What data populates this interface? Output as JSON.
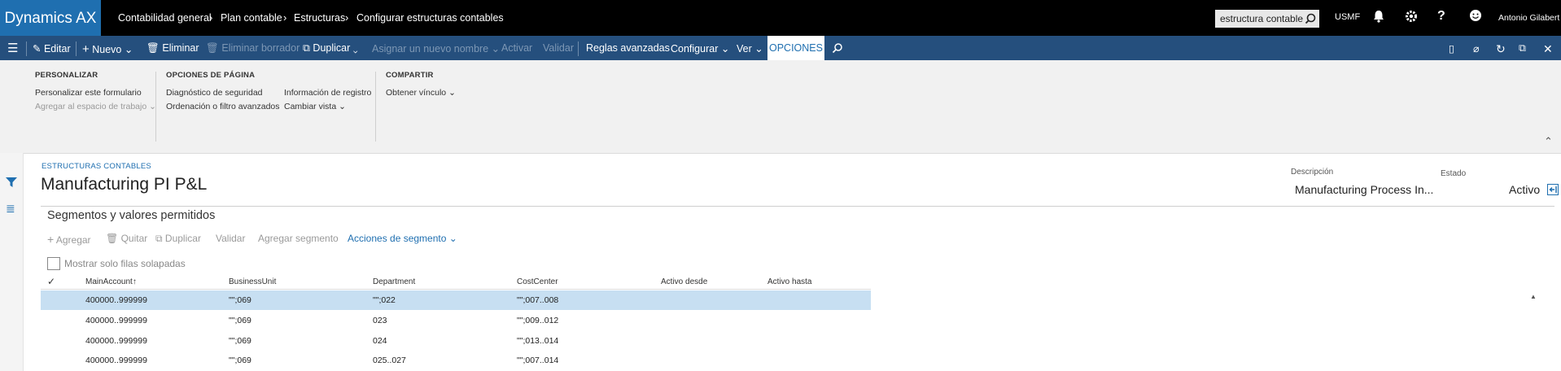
{
  "topbar": {
    "brand": "Dynamics AX",
    "breadcrumb": [
      "Contabilidad general",
      "Plan contable",
      "Estructuras",
      "Configurar estructuras contables"
    ],
    "search_value": "estructura contable",
    "company": "USMF",
    "user": "Antonio Gilabert"
  },
  "actionbar": {
    "edit": "Editar",
    "new": "Nuevo",
    "delete": "Eliminar",
    "delete_draft": "Eliminar borrador",
    "duplicate": "Duplicar",
    "rename": "Asignar un nuevo nombre",
    "activate": "Activar",
    "validate": "Validar",
    "advanced_rules": "Reglas avanzadas",
    "configure": "Configurar",
    "view": "Ver",
    "options": "OPCIONES"
  },
  "ribbon": {
    "personalize": {
      "title": "PERSONALIZAR",
      "items": [
        "Personalizar este formulario",
        "Agregar al espacio de trabajo"
      ]
    },
    "page_options": {
      "title": "OPCIONES DE PÁGINA",
      "items": [
        "Diagnóstico de seguridad",
        "Ordenación o filtro avanzados",
        "Información de registro",
        "Cambiar vista"
      ]
    },
    "share": {
      "title": "COMPARTIR",
      "items": [
        "Obtener vínculo"
      ]
    }
  },
  "header": {
    "eyebrow": "ESTRUCTURAS CONTABLES",
    "title": "Manufacturing PI P&L",
    "description_label": "Descripción",
    "description_value": "Manufacturing Process In...",
    "status_label": "Estado",
    "status_value": "Activo"
  },
  "segments": {
    "title": "Segmentos y valores permitidos",
    "toolbar": {
      "add": "Agregar",
      "remove": "Quitar",
      "duplicate": "Duplicar",
      "validate": "Validar",
      "add_segment": "Agregar segmento",
      "segment_actions": "Acciones de segmento"
    },
    "overlap_label": "Mostrar solo filas solapadas",
    "columns": [
      "MainAccount",
      "BusinessUnit",
      "Department",
      "CostCenter",
      "Activo desde",
      "Activo hasta"
    ],
    "rows": [
      [
        "400000..999999",
        "\"\";069",
        "\"\";022",
        "\"\";007..008",
        "",
        ""
      ],
      [
        "400000..999999",
        "\"\";069",
        "023",
        "\"\";009..012",
        "",
        ""
      ],
      [
        "400000..999999",
        "\"\";069",
        "024",
        "\"\";013..014",
        "",
        ""
      ],
      [
        "400000..999999",
        "\"\";069",
        "025..027",
        "\"\";007..014",
        "",
        ""
      ]
    ]
  },
  "colors": {
    "brand": "#1f6fb0",
    "actionbar": "#254f7d",
    "selected_row": "#c7dff2"
  }
}
